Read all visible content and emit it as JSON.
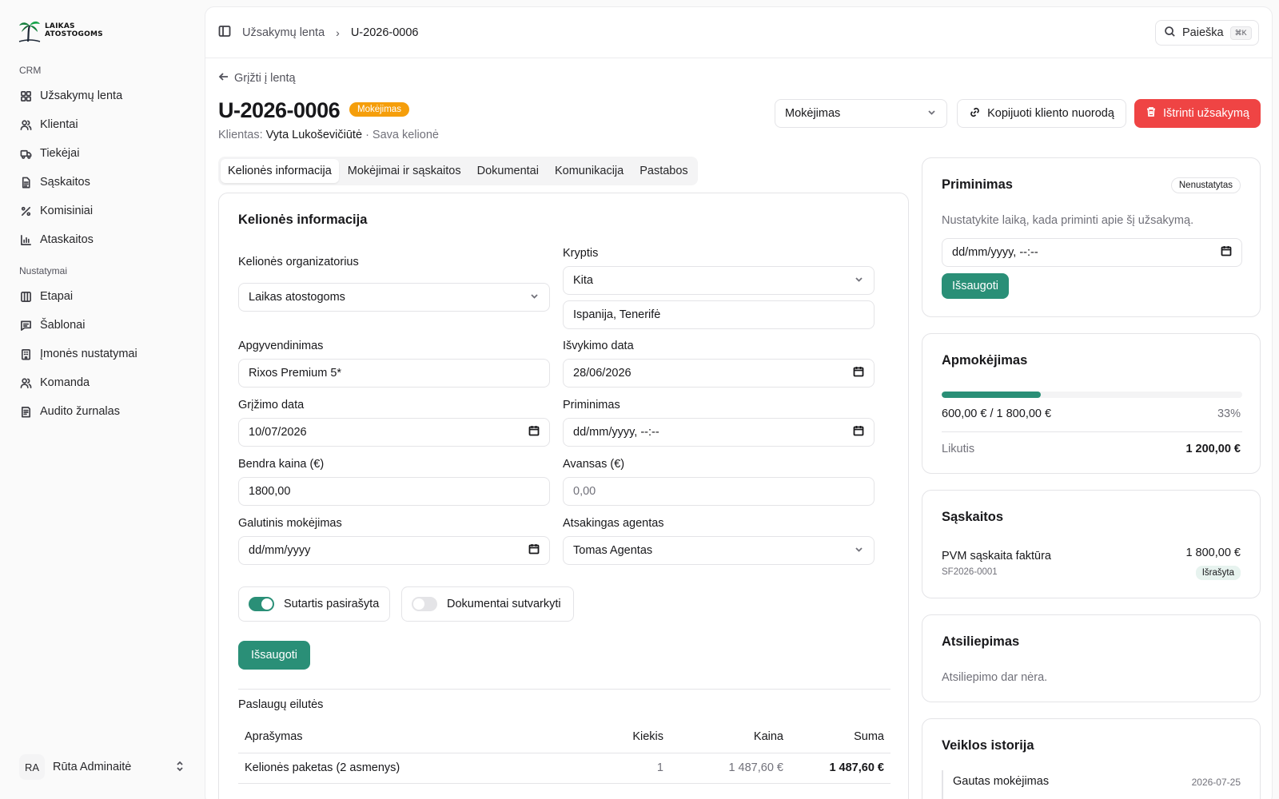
{
  "sidebar": {
    "logo_line1": "LAIKAS",
    "logo_line2": "ATOSTOGOMS",
    "section_crm": "CRM",
    "section_settings": "Nustatymai",
    "crm_items": [
      {
        "label": "Užsakymų lenta",
        "icon": "grid-icon"
      },
      {
        "label": "Klientai",
        "icon": "users-icon"
      },
      {
        "label": "Tiekėjai",
        "icon": "truck-icon"
      },
      {
        "label": "Sąskaitos",
        "icon": "file-icon"
      },
      {
        "label": "Komisiniai",
        "icon": "percent-icon"
      },
      {
        "label": "Ataskaitos",
        "icon": "chart-icon"
      }
    ],
    "settings_items": [
      {
        "label": "Etapai",
        "icon": "columns-icon"
      },
      {
        "label": "Šablonai",
        "icon": "message-icon"
      },
      {
        "label": "Įmonės nustatymai",
        "icon": "building-icon"
      },
      {
        "label": "Komanda",
        "icon": "users-icon"
      },
      {
        "label": "Audito žurnalas",
        "icon": "log-icon"
      }
    ],
    "user": {
      "initials": "RA",
      "name": "Rūta Adminaitė"
    }
  },
  "topbar": {
    "crumb_parent": "Užsakymų lenta",
    "crumb_current": "U-2026-0006",
    "search_label": "Paieška",
    "search_kbd": "⌘K"
  },
  "header": {
    "back_label": "Grįžti į lentą",
    "order_id": "U-2026-0006",
    "stage_badge": "Mokėjimas",
    "client_prefix": "Klientas:",
    "client_name": "Vyta Lukoševičiūtė",
    "trip_type": "· Sava kelionė",
    "stage_select": "Mokėjimas",
    "copy_button": "Kopijuoti kliento nuorodą",
    "delete_button": "Ištrinti užsakymą"
  },
  "tabs": [
    "Kelionės informacija",
    "Mokėjimai ir sąskaitos",
    "Dokumentai",
    "Komunikacija",
    "Pastabos"
  ],
  "form": {
    "title": "Kelionės informacija",
    "organizer_label": "Kelionės organizatorius",
    "organizer_value": "Laikas atostogoms",
    "direction_label": "Kryptis",
    "direction_value": "Kita",
    "direction_detail": "Ispanija, Tenerifė",
    "accommodation_label": "Apgyvendinimas",
    "accommodation_value": "Rixos Premium 5*",
    "departure_label": "Išvykimo data",
    "departure_value": "28/06/2026",
    "return_label": "Grįžimo data",
    "return_value": "10/07/2026",
    "reminder_label": "Priminimas",
    "reminder_value": "dd/mm/yyyy, --:--",
    "total_label": "Bendra kaina (€)",
    "total_value": "1800,00",
    "deposit_label": "Avansas (€)",
    "deposit_placeholder": "0,00",
    "final_label": "Galutinis mokėjimas",
    "final_value": "dd/mm/yyyy",
    "agent_label": "Atsakingas agentas",
    "agent_value": "Tomas Agentas",
    "contract_label": "Sutartis pasirašyta",
    "contract_on": true,
    "docs_label": "Dokumentai sutvarkyti",
    "docs_on": false,
    "save_button": "Išsaugoti"
  },
  "services": {
    "title": "Paslaugų eilutės",
    "headers": [
      "Aprašymas",
      "Kiekis",
      "Kaina",
      "Suma"
    ],
    "rows": [
      {
        "description": "Kelionės paketas (2 asmenys)",
        "qty": "1",
        "price": "1 487,60 €",
        "sum": "1 487,60 €"
      }
    ]
  },
  "reminder_card": {
    "title": "Priminimas",
    "status": "Nenustatytas",
    "hint": "Nustatykite laiką, kada priminti apie šį užsakymą.",
    "value": "dd/mm/yyyy, --:--",
    "save_button": "Išsaugoti"
  },
  "payment_card": {
    "title": "Apmokėjimas",
    "progress": 0.33,
    "amount_text": "600,00 € / 1 800,00 €",
    "percent_text": "33%",
    "remaining_label": "Likutis",
    "remaining_value": "1 200,00 €"
  },
  "invoices_card": {
    "title": "Sąskaitos",
    "invoice_name": "PVM sąskaita faktūra",
    "invoice_number": "SF2026-0001",
    "invoice_amount": "1 800,00 €",
    "invoice_status": "Išrašyta"
  },
  "feedback_card": {
    "title": "Atsiliepimas",
    "empty_text": "Atsiliepimo dar nėra."
  },
  "activity_card": {
    "title": "Veiklos istorija",
    "items": [
      {
        "label": "Gautas mokėjimas",
        "date": "2026-07-25"
      }
    ]
  },
  "colors": {
    "accent": "#2a8f77",
    "danger": "#ef4444",
    "stage": "#f59e0b"
  }
}
